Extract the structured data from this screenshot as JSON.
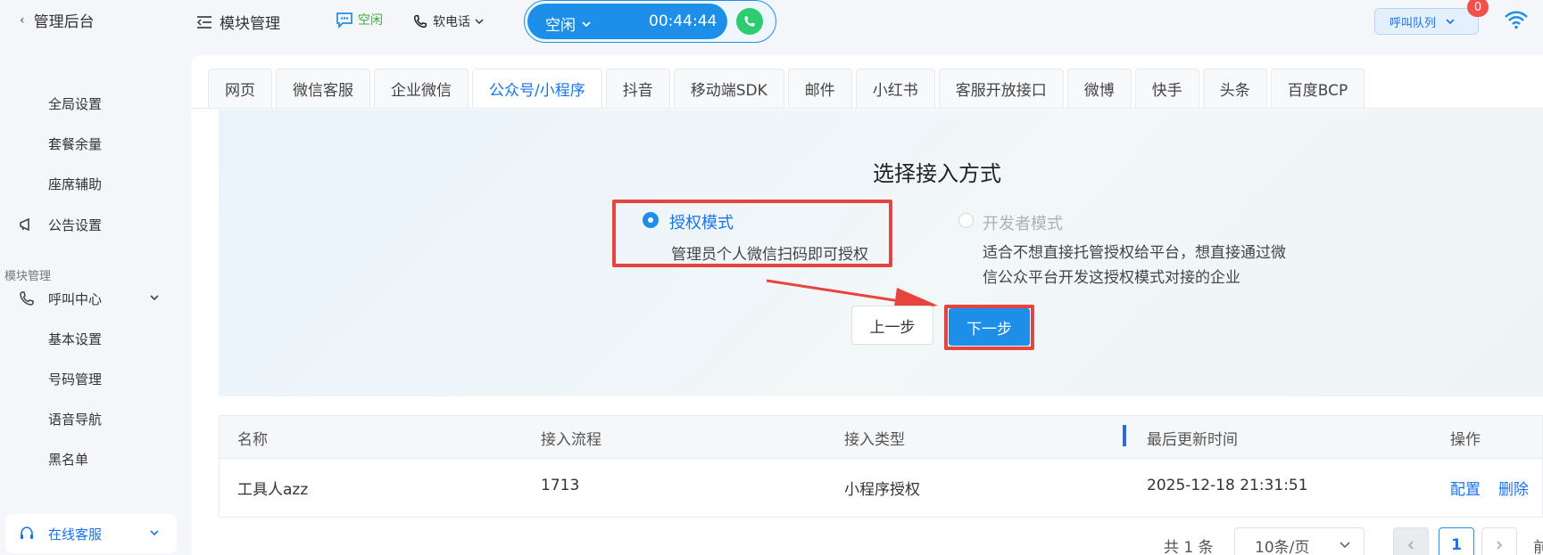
{
  "sidebar": {
    "title": "管理后台",
    "items": [
      {
        "label": "全局设置"
      },
      {
        "label": "套餐余量"
      },
      {
        "label": "座席辅助"
      },
      {
        "label": "公告设置"
      },
      {
        "label": "呼叫中心"
      },
      {
        "label": "基本设置"
      },
      {
        "label": "号码管理"
      },
      {
        "label": "语音导航"
      },
      {
        "label": "黑名单"
      },
      {
        "label": "在线客服"
      }
    ],
    "section": "模块管理"
  },
  "header": {
    "module": "模块管理",
    "status": "空闲",
    "phone": "软电话",
    "call_status": "空闲",
    "call_timer": "00:44:44",
    "queue": "呼叫队列",
    "badge": "0"
  },
  "tabs": [
    "网页",
    "微信客服",
    "企业微信",
    "公众号/小程序",
    "抖音",
    "移动端SDK",
    "邮件",
    "小红书",
    "客服开放接口",
    "微博",
    "快手",
    "头条",
    "百度BCP"
  ],
  "active_tab": "公众号/小程序",
  "access": {
    "title": "选择接入方式",
    "option1_title": "授权模式",
    "option1_desc": "管理员个人微信扫码即可授权",
    "option2_title": "开发者模式",
    "option2_desc": "适合不想直接托管授权给平台，想直接通过微信公众平台开发这授权模式对接的企业",
    "prev": "上一步",
    "next": "下一步"
  },
  "table": {
    "headers": [
      "名称",
      "接入流程",
      "接入类型",
      "最后更新时间",
      "操作"
    ],
    "rows": [
      {
        "name": "工具人azz",
        "flow": "1713",
        "type": "小程序授权",
        "updated": "2025-12-18 21:31:51",
        "op1": "配置",
        "op2": "删除"
      }
    ]
  },
  "pagination": {
    "total": "共 1 条",
    "size": "10条/页",
    "current": "1",
    "goto": "前"
  }
}
